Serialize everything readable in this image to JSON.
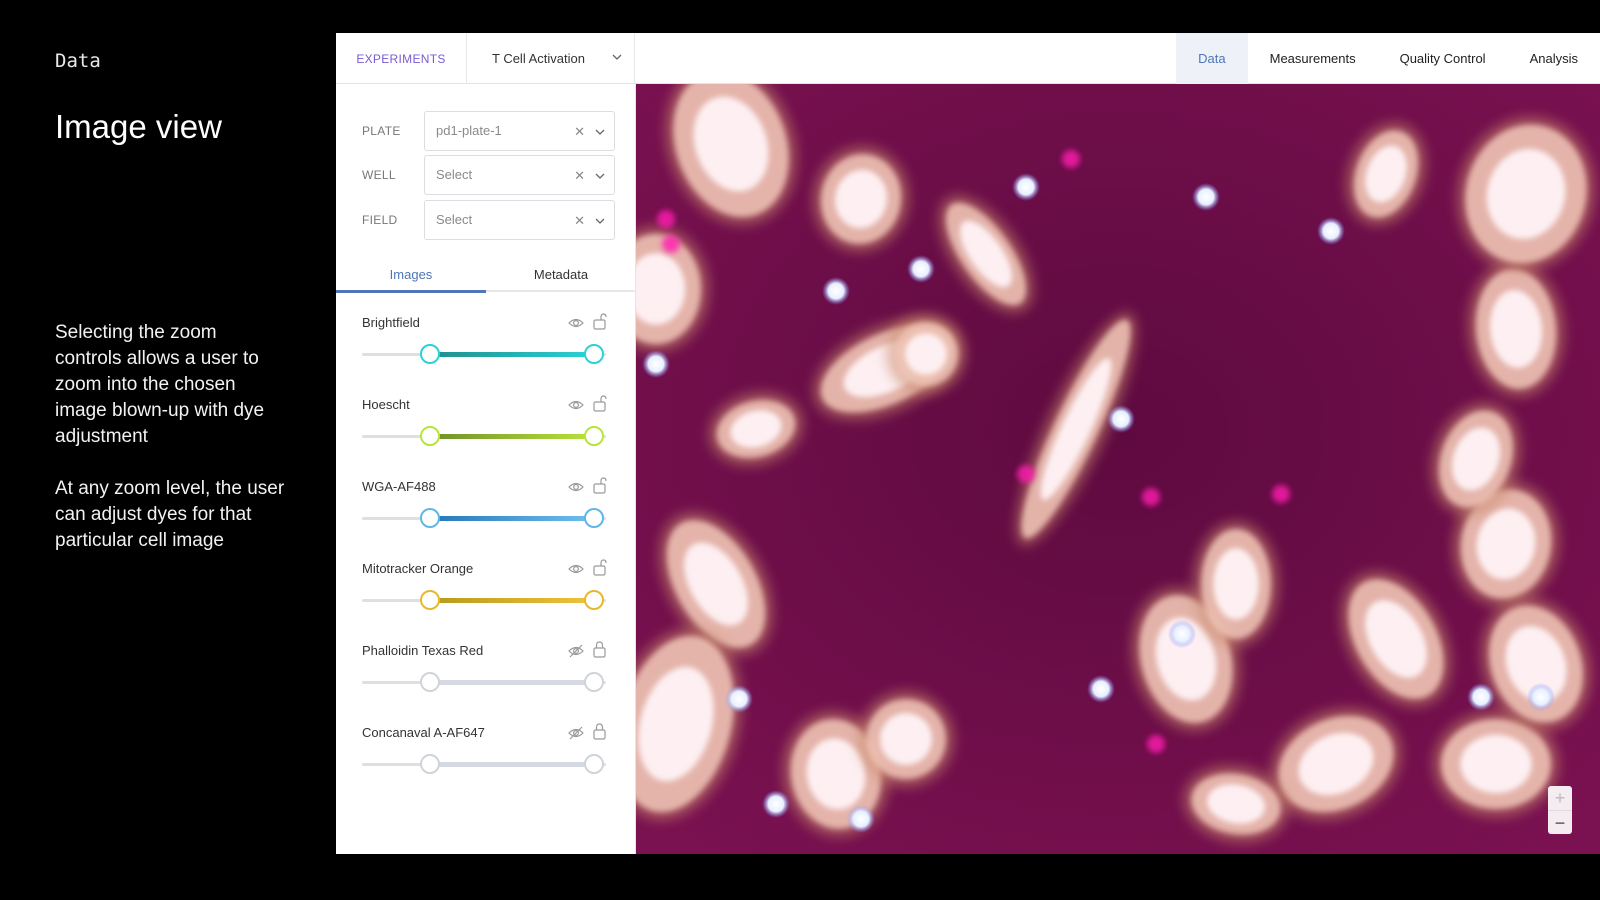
{
  "caption": {
    "label": "Data",
    "title": "Image view",
    "paragraph1": "Selecting the zoom controls  allows a user to zoom into the chosen image blown-up with dye adjustment",
    "paragraph2": "At any zoom level, the user can adjust dyes for that particular cell image"
  },
  "header": {
    "experiments_label": "EXPERIMENTS",
    "experiment_value": "T Cell Activation",
    "nav": [
      {
        "label": "Data",
        "active": true
      },
      {
        "label": "Measurements",
        "active": false
      },
      {
        "label": "Quality Control",
        "active": false
      },
      {
        "label": "Analysis",
        "active": false
      }
    ]
  },
  "filters": [
    {
      "label": "PLATE",
      "value": "pd1-plate-1"
    },
    {
      "label": "WELL",
      "value": "Select"
    },
    {
      "label": "FIELD",
      "value": "Select"
    }
  ],
  "tabs": [
    {
      "label": "Images",
      "active": true
    },
    {
      "label": "Metadata",
      "active": false
    }
  ],
  "channels": [
    {
      "name": "Brightfield",
      "visible": true,
      "locked": false,
      "min": 0.28,
      "max": 0.95,
      "color_start": "#1e8f8a",
      "color_end": "#2ad2d8",
      "knob_color": "#2ad2d8"
    },
    {
      "name": "Hoescht",
      "visible": true,
      "locked": false,
      "min": 0.28,
      "max": 0.95,
      "color_start": "#6e8f2a",
      "color_end": "#b9e53a",
      "knob_color": "#b9e53a"
    },
    {
      "name": "WGA-AF488",
      "visible": true,
      "locked": false,
      "min": 0.28,
      "max": 0.95,
      "color_start": "#2477b8",
      "color_end": "#6fc0ef",
      "knob_color": "#5fb6e8"
    },
    {
      "name": "Mitotracker Orange",
      "visible": true,
      "locked": false,
      "min": 0.28,
      "max": 0.95,
      "color_start": "#b59a1c",
      "color_end": "#f2c23a",
      "knob_color": "#e6b92b"
    },
    {
      "name": "Phalloidin Texas Red",
      "visible": false,
      "locked": true,
      "min": 0.28,
      "max": 0.95,
      "color_start": "#d5d9e2",
      "color_end": "#d5d9e2",
      "knob_color": "#d0d3d8"
    },
    {
      "name": "Concanaval A-AF647",
      "visible": false,
      "locked": true,
      "min": 0.28,
      "max": 0.95,
      "color_start": "#d5d9e2",
      "color_end": "#d5d9e2",
      "knob_color": "#d0d3d8"
    }
  ],
  "zoom": {
    "in": "+",
    "out": "−"
  },
  "colors": {
    "accent": "#4d77b8",
    "experiments": "#7a5bd3",
    "image_bg": "#6a0c46"
  }
}
